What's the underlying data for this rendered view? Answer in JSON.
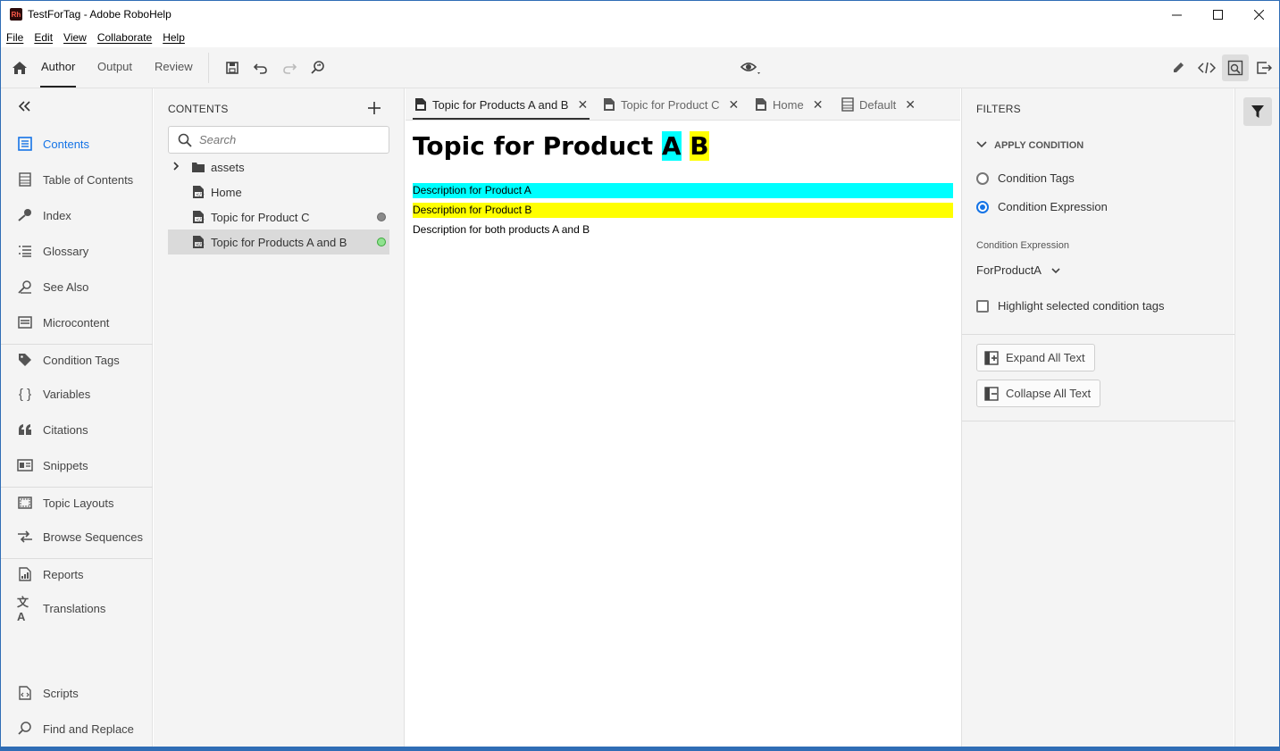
{
  "window": {
    "title": "TestForTag - Adobe RoboHelp",
    "logo_text": "Rh"
  },
  "window_controls": {
    "minimize": "—",
    "maximize": "☐",
    "close": "✕"
  },
  "menu": [
    "File",
    "Edit",
    "View",
    "Collaborate",
    "Help"
  ],
  "toolbar": {
    "tabs": [
      "Author",
      "Output",
      "Review"
    ],
    "active_tab": "Author"
  },
  "leftnav": {
    "items": [
      {
        "label": "Contents",
        "icon": "contents-icon",
        "active": true
      },
      {
        "label": "Table of Contents",
        "icon": "toc-icon"
      },
      {
        "label": "Index",
        "icon": "key-icon"
      },
      {
        "label": "Glossary",
        "icon": "glossary-icon"
      },
      {
        "label": "See Also",
        "icon": "see-also-icon"
      },
      {
        "label": "Microcontent",
        "icon": "microcontent-icon"
      },
      {
        "label": "Condition Tags",
        "icon": "tag-icon"
      },
      {
        "label": "Variables",
        "icon": "braces-icon"
      },
      {
        "label": "Citations",
        "icon": "quote-icon"
      },
      {
        "label": "Snippets",
        "icon": "snippet-icon"
      },
      {
        "label": "Topic Layouts",
        "icon": "layout-icon"
      },
      {
        "label": "Browse Sequences",
        "icon": "sequence-icon"
      },
      {
        "label": "Reports",
        "icon": "reports-icon"
      },
      {
        "label": "Translations",
        "icon": "translate-icon"
      },
      {
        "label": "Scripts",
        "icon": "scripts-icon"
      },
      {
        "label": "Find and Replace",
        "icon": "find-replace-icon"
      }
    ]
  },
  "contents": {
    "title": "CONTENTS",
    "search_placeholder": "Search",
    "tree": [
      {
        "label": "assets",
        "type": "folder"
      },
      {
        "label": "Home",
        "type": "topic"
      },
      {
        "label": "Topic for Product C",
        "type": "topic",
        "status": "gray"
      },
      {
        "label": "Topic for Products A and B",
        "type": "topic",
        "status": "green",
        "selected": true
      }
    ]
  },
  "editor": {
    "tabs": [
      {
        "label": "Topic for Products A and B",
        "active": true
      },
      {
        "label": "Topic for Product C"
      },
      {
        "label": "Home"
      },
      {
        "label": "Default"
      }
    ],
    "doc": {
      "title_prefix": "Topic for Product ",
      "title_a": "A",
      "title_b": "B",
      "lines": [
        {
          "text": "Description for Product A",
          "highlight": "#00ffff"
        },
        {
          "text": "Description for Product B",
          "highlight": "#ffff00"
        },
        {
          "text": "Description for both products A and B",
          "highlight": ""
        }
      ]
    }
  },
  "filters": {
    "title": "FILTERS",
    "section": "APPLY CONDITION",
    "options": [
      "Condition Tags",
      "Condition Expression"
    ],
    "selected_option": "Condition Expression",
    "expression_label": "Condition Expression",
    "expression_value": "ForProductA",
    "highlight_checkbox": "Highlight selected condition tags",
    "highlight_checked": false,
    "expand_all": "Expand All Text",
    "collapse_all": "Collapse All Text"
  },
  "colors": {
    "accent": "#1473e6",
    "highlight_a": "#00ffff",
    "highlight_b": "#ffff00",
    "status_green": "#4caf50",
    "status_gray": "#8a8a8a"
  }
}
